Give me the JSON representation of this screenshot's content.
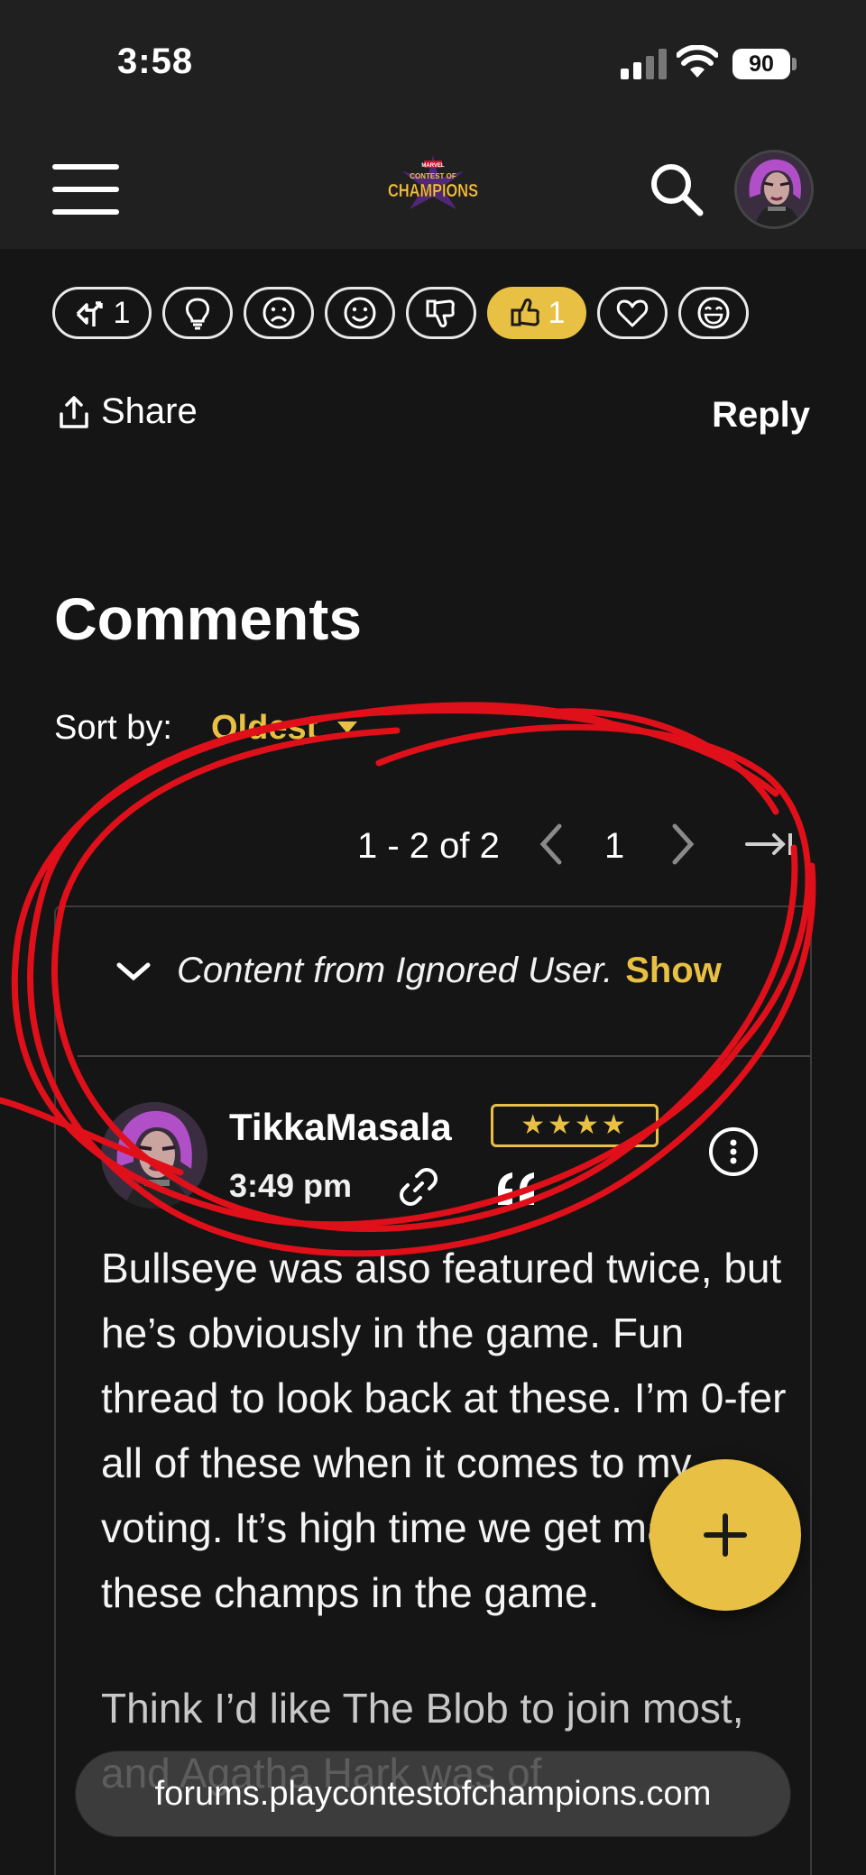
{
  "status_bar": {
    "time": "3:58",
    "battery": "90"
  },
  "nav": {
    "logo_lines": [
      "MARVEL",
      "CONTEST OF",
      "CHAMPIONS"
    ]
  },
  "reactions": [
    {
      "icon": "agree-arrow-icon",
      "count": "1",
      "active": false
    },
    {
      "icon": "lightbulb-icon",
      "count": "",
      "active": false
    },
    {
      "icon": "sad-face-icon",
      "count": "",
      "active": false
    },
    {
      "icon": "smile-face-icon",
      "count": "",
      "active": false
    },
    {
      "icon": "thumbs-down-icon",
      "count": "",
      "active": false
    },
    {
      "icon": "thumbs-up-icon",
      "count": "1",
      "active": true
    },
    {
      "icon": "heart-icon",
      "count": "",
      "active": false
    },
    {
      "icon": "laugh-face-icon",
      "count": "",
      "active": false
    }
  ],
  "actions": {
    "share_label": "Share",
    "reply_label": "Reply"
  },
  "comments": {
    "title": "Comments",
    "sort_label": "Sort by:",
    "sort_value": "Oldest",
    "pager": {
      "count": "1 - 2 of 2",
      "page": "1"
    },
    "ignored_notice": "Content from Ignored User.",
    "show_label": "Show",
    "comment": {
      "username": "TikkaMasala",
      "rank_stars": "★★★★",
      "time": "3:49 pm",
      "paragraphs": [
        "Bullseye was also featured twice, but he’s obviously in the game. Fun thread to look back at these. I’m 0-fer all of these when it comes to my voting. It’s high time we get many of these champs in the game.",
        "Think I’d like The Blob to join most, and Agatha Hark was of"
      ]
    }
  },
  "browser": {
    "url": "forums.playcontestofchampions.com"
  },
  "colors": {
    "accent": "#e8c043",
    "background": "#151515",
    "header": "#202020",
    "annotation": "#e0101a"
  }
}
